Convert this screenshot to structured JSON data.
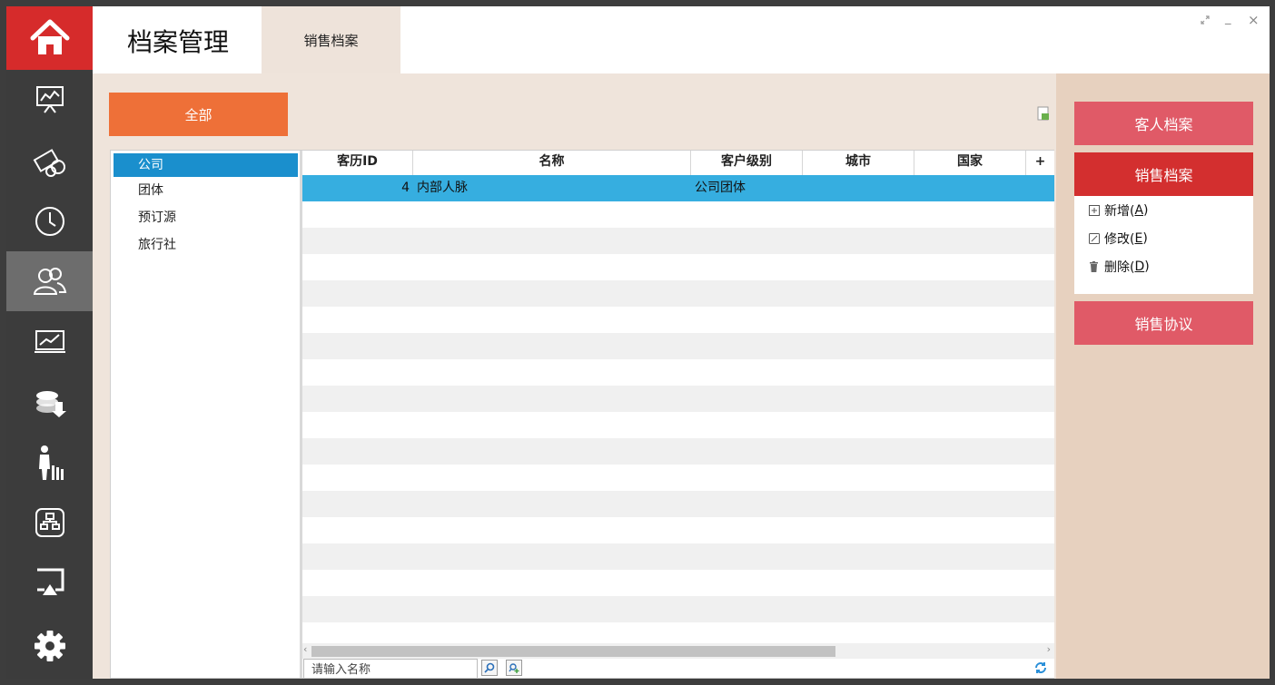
{
  "header": {
    "app_title": "档案管理",
    "active_tab": "销售档案"
  },
  "nav": {
    "items": [
      "home-icon",
      "presentation-icon",
      "money-icon",
      "clock-icon",
      "users-icon",
      "trend-chart-icon",
      "coins-icon",
      "guest-icon",
      "org-chart-icon",
      "screen-cast-icon",
      "gear-icon"
    ],
    "active": "users-icon"
  },
  "filter": {
    "all_label": "全部"
  },
  "categories": {
    "items": [
      "公司",
      "团体",
      "预订源",
      "旅行社"
    ],
    "selected": "公司"
  },
  "table": {
    "columns": [
      "客历ID",
      "名称",
      "客户级别",
      "城市",
      "国家"
    ],
    "rows": [
      {
        "id": "4",
        "name": "内部人脉",
        "level": "公司团体",
        "city": "",
        "country": ""
      }
    ]
  },
  "search": {
    "placeholder": "请输入名称"
  },
  "sidebar_right": {
    "guest_archive": "客人档案",
    "sales_archive": "销售档案",
    "add_label": "新增(",
    "add_key": "A",
    "edit_label": "修改(",
    "edit_key": "E",
    "delete_label": "删除(",
    "delete_key": "D",
    "close_paren": ")",
    "sales_agreement": "销售协议"
  },
  "colors": {
    "brand_red": "#d62b2b",
    "orange": "#ee7038",
    "pink": "#e05a67",
    "selection_blue": "#36aee0"
  }
}
